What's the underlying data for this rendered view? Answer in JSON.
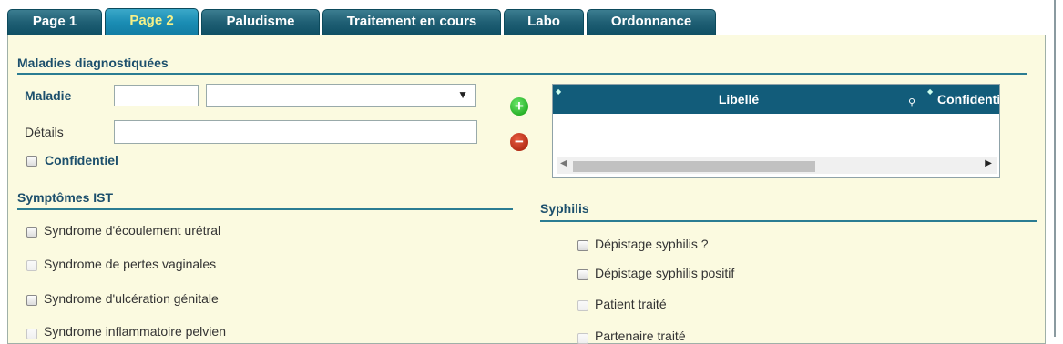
{
  "tabs": [
    {
      "label": "Page 1",
      "active": false
    },
    {
      "label": "Page 2",
      "active": true
    },
    {
      "label": "Paludisme",
      "active": false
    },
    {
      "label": "Traitement en cours",
      "active": false
    },
    {
      "label": "Labo",
      "active": false
    },
    {
      "label": "Ordonnance",
      "active": false
    }
  ],
  "diag": {
    "title": "Maladies diagnostiquées",
    "maladie_label": "Maladie",
    "maladie_code": "",
    "maladie_select": "",
    "details_label": "Détails",
    "details_value": "",
    "confidentiel_label": "Confidentiel",
    "confidentiel_checked": false
  },
  "grid": {
    "col1": "Libellé",
    "col2": "Confidentiel"
  },
  "ist": {
    "title": "Symptômes IST",
    "items": [
      {
        "label": "Syndrome d'écoulement urétral",
        "disabled": false
      },
      {
        "label": "Syndrome de pertes vaginales",
        "disabled": true
      },
      {
        "label": "Syndrome d'ulcération génitale",
        "disabled": false
      },
      {
        "label": "Syndrome inflammatoire pelvien",
        "disabled": true
      }
    ]
  },
  "syphilis": {
    "title": "Syphilis",
    "items": [
      {
        "label": "Dépistage syphilis ?",
        "disabled": false
      },
      {
        "label": "Dépistage syphilis positif",
        "disabled": false
      },
      {
        "label": "Patient traité",
        "disabled": true
      },
      {
        "label": "Partenaire traité",
        "disabled": true
      }
    ]
  },
  "colors": {
    "tab": "#1f5f74",
    "tab_active": "#1b8db4",
    "panel_bg": "#fbfae0",
    "accent": "#125c7a"
  },
  "icons": {
    "add": "plus-circle-icon",
    "remove": "minus-circle-icon"
  }
}
